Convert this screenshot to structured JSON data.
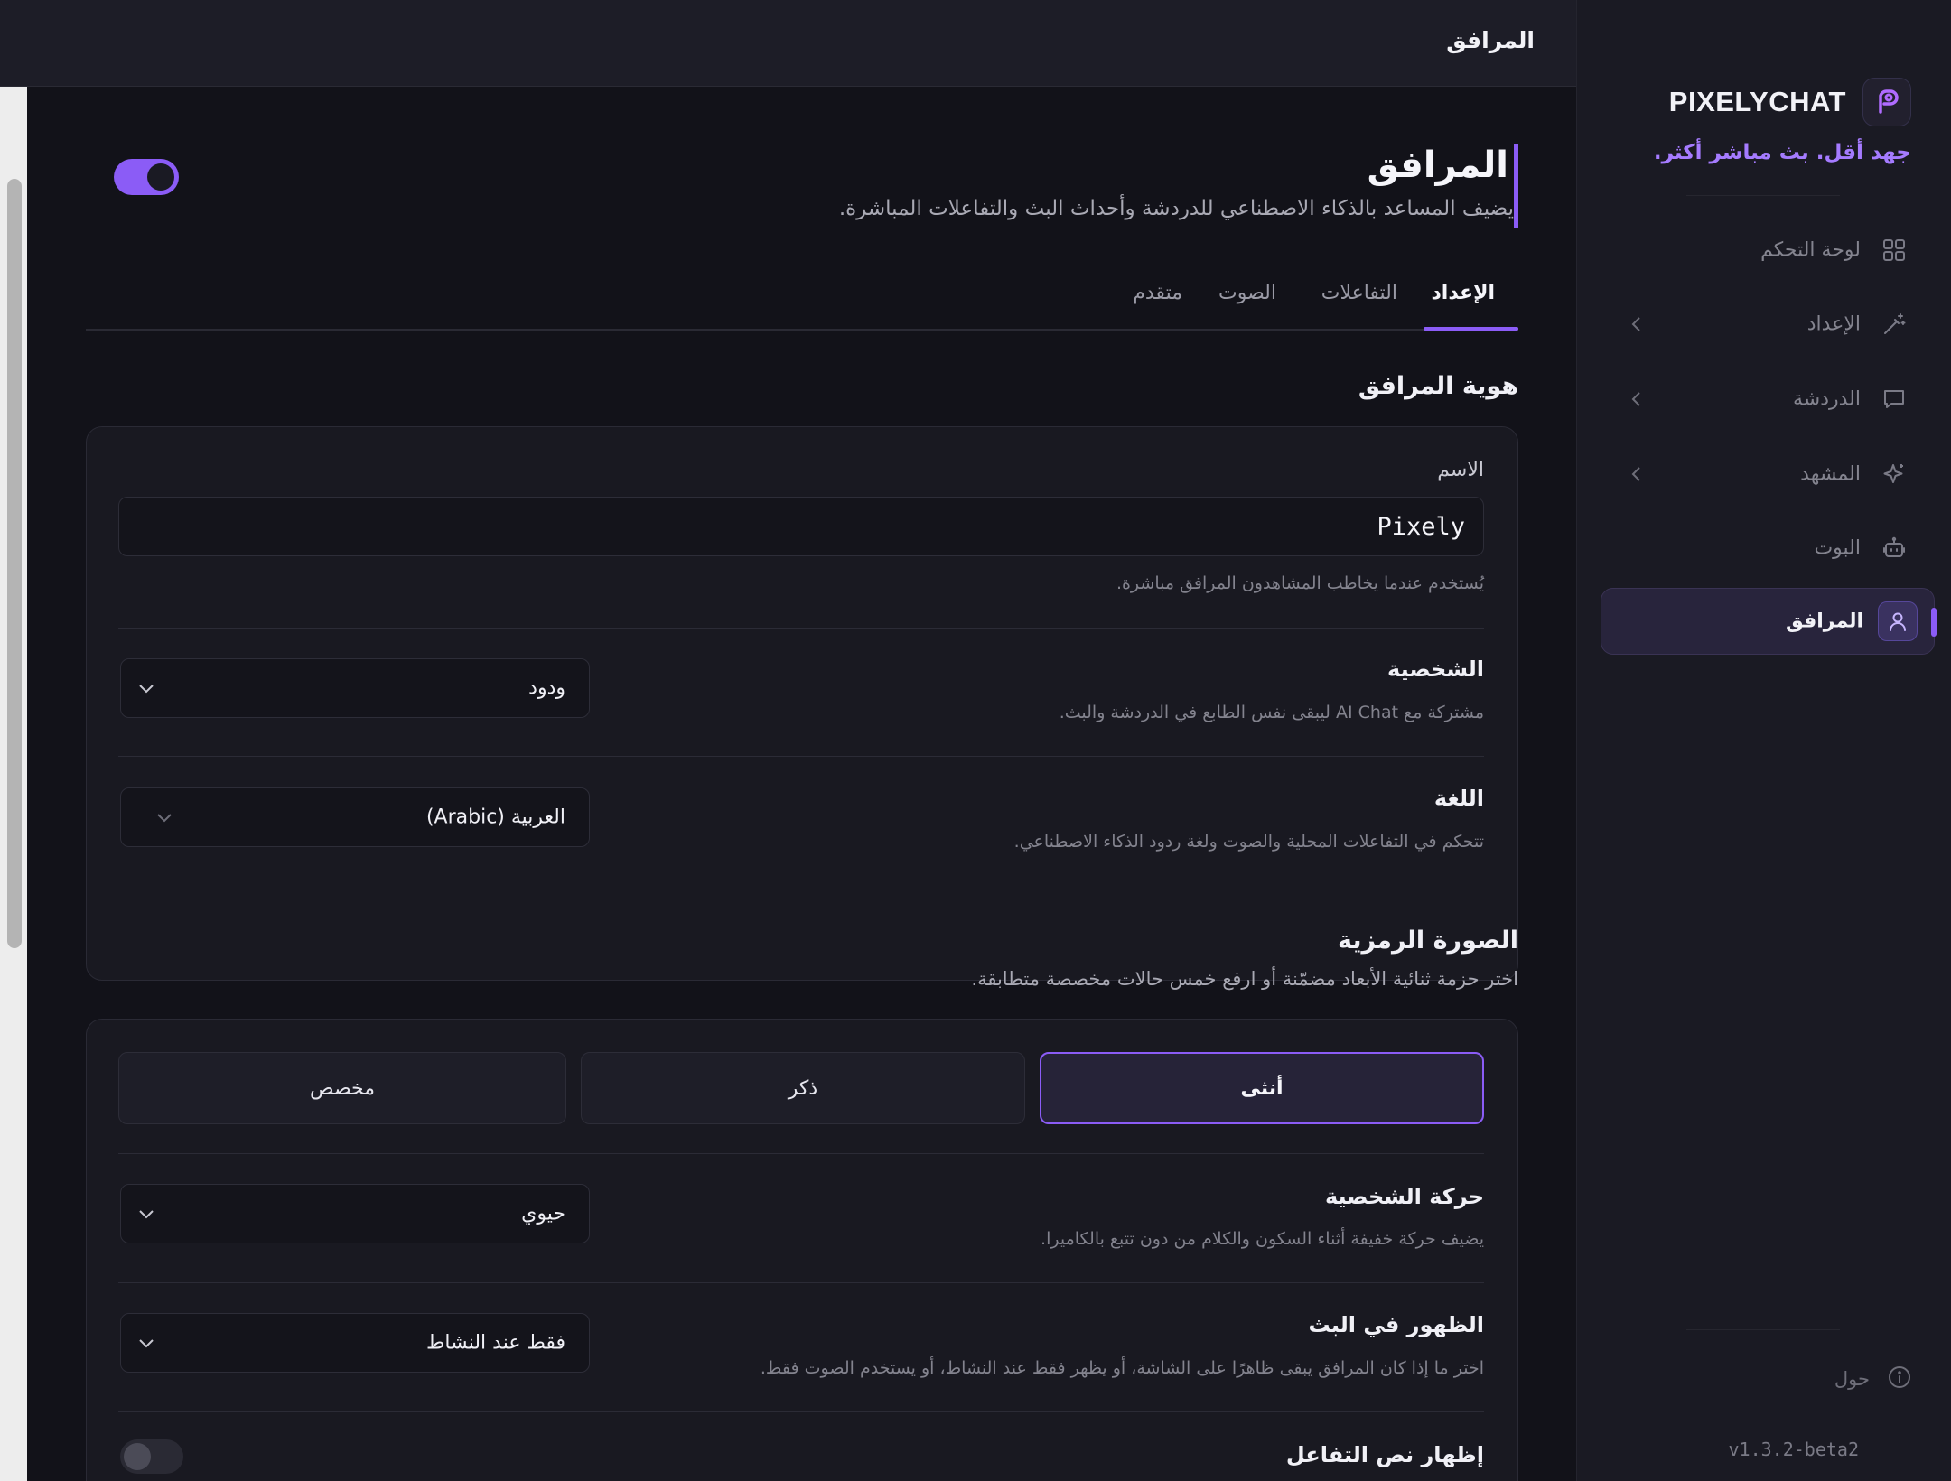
{
  "brand": {
    "name": "PIXELYCHAT",
    "tagline": "جهد أقل. بث مباشر أكثر."
  },
  "sidebar": {
    "items": [
      {
        "label": "لوحة التحكم",
        "icon": "dashboard-grid-icon",
        "chevron": false
      },
      {
        "label": "الإعداد",
        "icon": "setup-wand-icon",
        "chevron": true
      },
      {
        "label": "الدردشة",
        "icon": "chat-bubble-icon",
        "chevron": true
      },
      {
        "label": "المشهد",
        "icon": "sparkle-icon",
        "chevron": true
      },
      {
        "label": "البوت",
        "icon": "bot-icon",
        "chevron": false
      },
      {
        "label": "المرافق",
        "icon": "user-icon",
        "chevron": false,
        "active": true
      }
    ],
    "about": "حول",
    "version": "v1.3.2-beta2"
  },
  "topbar": {
    "title": "المرافق"
  },
  "page": {
    "title": "المرافق",
    "subtitle": "يضيف المساعد بالذكاء الاصطناعي للدردشة وأحداث البث والتفاعلات المباشرة.",
    "enabled": true
  },
  "tabs": [
    {
      "label": "الإعداد",
      "active": true
    },
    {
      "label": "التفاعلات",
      "active": false
    },
    {
      "label": "الصوت",
      "active": false
    },
    {
      "label": "متقدم",
      "active": false
    }
  ],
  "identity": {
    "title": "هوية المرافق",
    "name_label": "الاسم",
    "name_value": "Pixely",
    "name_hint": "يُستخدم عندما يخاطب المشاهدون المرافق مباشرة.",
    "personality": {
      "title": "الشخصية",
      "desc": "مشتركة مع AI Chat ليبقى نفس الطابع في الدردشة والبث.",
      "value": "ودود"
    },
    "language": {
      "title": "اللغة",
      "desc": "تتحكم في التفاعلات المحلية والصوت ولغة ردود الذكاء الاصطناعي.",
      "value": "العربية (Arabic)"
    }
  },
  "avatar": {
    "title": "الصورة الرمزية",
    "subtitle": "اختر حزمة ثنائية الأبعاد مضمّنة أو ارفع خمس حالات مخصصة متطابقة.",
    "options": [
      {
        "label": "أنثى",
        "active": true
      },
      {
        "label": "ذكر",
        "active": false
      },
      {
        "label": "مخصص",
        "active": false
      }
    ],
    "motion": {
      "title": "حركة الشخصية",
      "desc": "يضيف حركة خفيفة أثناء السكون والكلام من دون تتبع بالكاميرا.",
      "value": "حيوي"
    },
    "visibility": {
      "title": "الظهور في البث",
      "desc": "اختر ما إذا كان المرافق يبقى ظاهرًا على الشاشة، أو يظهر فقط عند النشاط، أو يستخدم الصوت فقط.",
      "value": "فقط عند النشاط"
    },
    "show_text": {
      "title": "إظهار نص التفاعل",
      "enabled": false
    }
  },
  "colors": {
    "accent": "#8b5cf6",
    "tagline": "#a57bff",
    "background": "#121219",
    "sidebar": "#1a1a23",
    "card": "#191921"
  }
}
